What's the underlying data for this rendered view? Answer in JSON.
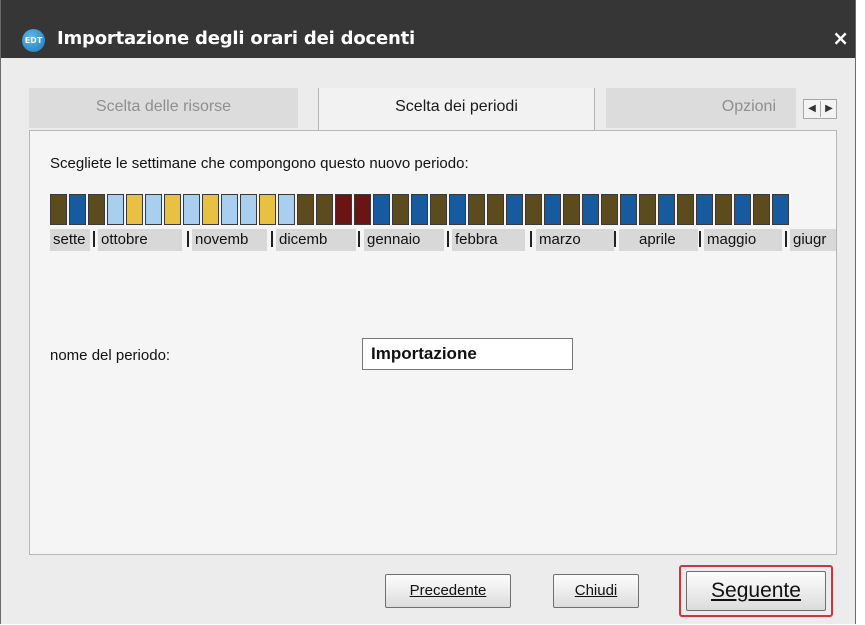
{
  "window": {
    "title": "Importazione degli orari dei docenti",
    "app_icon_text": "EDT",
    "close_glyph": "×"
  },
  "tabs": [
    {
      "label": "Scelta delle risorse",
      "active": false
    },
    {
      "label": "Scelta dei periodi",
      "active": true
    },
    {
      "label": "Opzioni",
      "active": false
    }
  ],
  "tab_scroll": {
    "left": "◀",
    "right": "▶"
  },
  "panel": {
    "instruction": "Scegliete le settimane che compongono questo nuovo periodo:",
    "weeks": [
      "#5c4b1c",
      "#165aa0",
      "#5c4b1c",
      "#a9cff0",
      "#e8c042",
      "#a9cff0",
      "#e8c042",
      "#a9cff0",
      "#e8c042",
      "#a9cff0",
      "#a9cff0",
      "#e8c042",
      "#a9cff0",
      "#5c4b1c",
      "#5c4b1c",
      "#6a1414",
      "#6a1414",
      "#165aa0",
      "#5c4b1c",
      "#165aa0",
      "#5c4b1c",
      "#165aa0",
      "#5c4b1c",
      "#5c4b1c",
      "#165aa0",
      "#5c4b1c",
      "#165aa0",
      "#5c4b1c",
      "#165aa0",
      "#5c4b1c",
      "#165aa0",
      "#5c4b1c",
      "#165aa0",
      "#5c4b1c",
      "#165aa0",
      "#5c4b1c",
      "#165aa0",
      "#5c4b1c",
      "#165aa0"
    ],
    "months": [
      "sette",
      "ottobre",
      "novemb",
      "dicemb",
      "gennaio",
      "febbra",
      "marzo",
      "aprile",
      "maggio",
      "giugr"
    ],
    "period_label": "nome del periodo:",
    "period_value": "Importazione"
  },
  "buttons": {
    "previous": "Precedente",
    "close": "Chiudi",
    "next": "Seguente",
    "highlight_color": "#d4333a"
  }
}
